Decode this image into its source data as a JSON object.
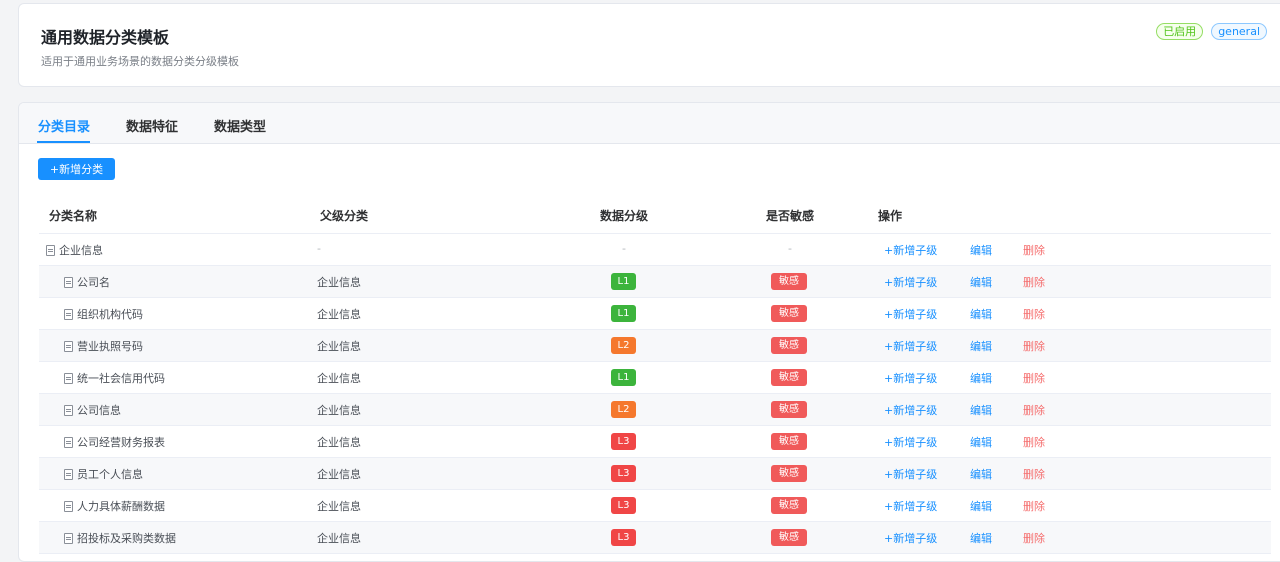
{
  "header": {
    "title": "通用数据分类模板",
    "subtitle": "适用于通用业务场景的数据分类分级模板",
    "status_badge": "已启用",
    "type_badge": "general"
  },
  "tabs": [
    {
      "label": "分类目录",
      "active": true
    },
    {
      "label": "数据特征",
      "active": false
    },
    {
      "label": "数据类型",
      "active": false
    }
  ],
  "toolbar": {
    "add_label": "+新增分类"
  },
  "table": {
    "columns": [
      "分类名称",
      "父级分类",
      "数据分级",
      "是否敏感",
      "操作"
    ],
    "actions": {
      "add_child": "+新增子级",
      "edit": "编辑",
      "delete": "删除"
    },
    "rows": [
      {
        "name": "企业信息",
        "parent": "-",
        "level": "-",
        "sensitive": "-",
        "indent": 0
      },
      {
        "name": "公司名",
        "parent": "企业信息",
        "level": "L1",
        "sensitive": "敏感",
        "indent": 1
      },
      {
        "name": "组织机构代码",
        "parent": "企业信息",
        "level": "L1",
        "sensitive": "敏感",
        "indent": 1
      },
      {
        "name": "营业执照号码",
        "parent": "企业信息",
        "level": "L2",
        "sensitive": "敏感",
        "indent": 1
      },
      {
        "name": "统一社会信用代码",
        "parent": "企业信息",
        "level": "L1",
        "sensitive": "敏感",
        "indent": 1
      },
      {
        "name": "公司信息",
        "parent": "企业信息",
        "level": "L2",
        "sensitive": "敏感",
        "indent": 1
      },
      {
        "name": "公司经营财务报表",
        "parent": "企业信息",
        "level": "L3",
        "sensitive": "敏感",
        "indent": 1
      },
      {
        "name": "员工个人信息",
        "parent": "企业信息",
        "level": "L3",
        "sensitive": "敏感",
        "indent": 1
      },
      {
        "name": "人力具体薪酬数据",
        "parent": "企业信息",
        "level": "L3",
        "sensitive": "敏感",
        "indent": 1
      },
      {
        "name": "招投标及采购类数据",
        "parent": "企业信息",
        "level": "L3",
        "sensitive": "敏感",
        "indent": 1
      }
    ]
  },
  "colors": {
    "accent": "#1890ff",
    "level_L1": "#3cb43c",
    "level_L2": "#f5782d",
    "level_L3": "#f04646",
    "sensitive": "#f05a5a",
    "danger": "#f56c6c"
  }
}
